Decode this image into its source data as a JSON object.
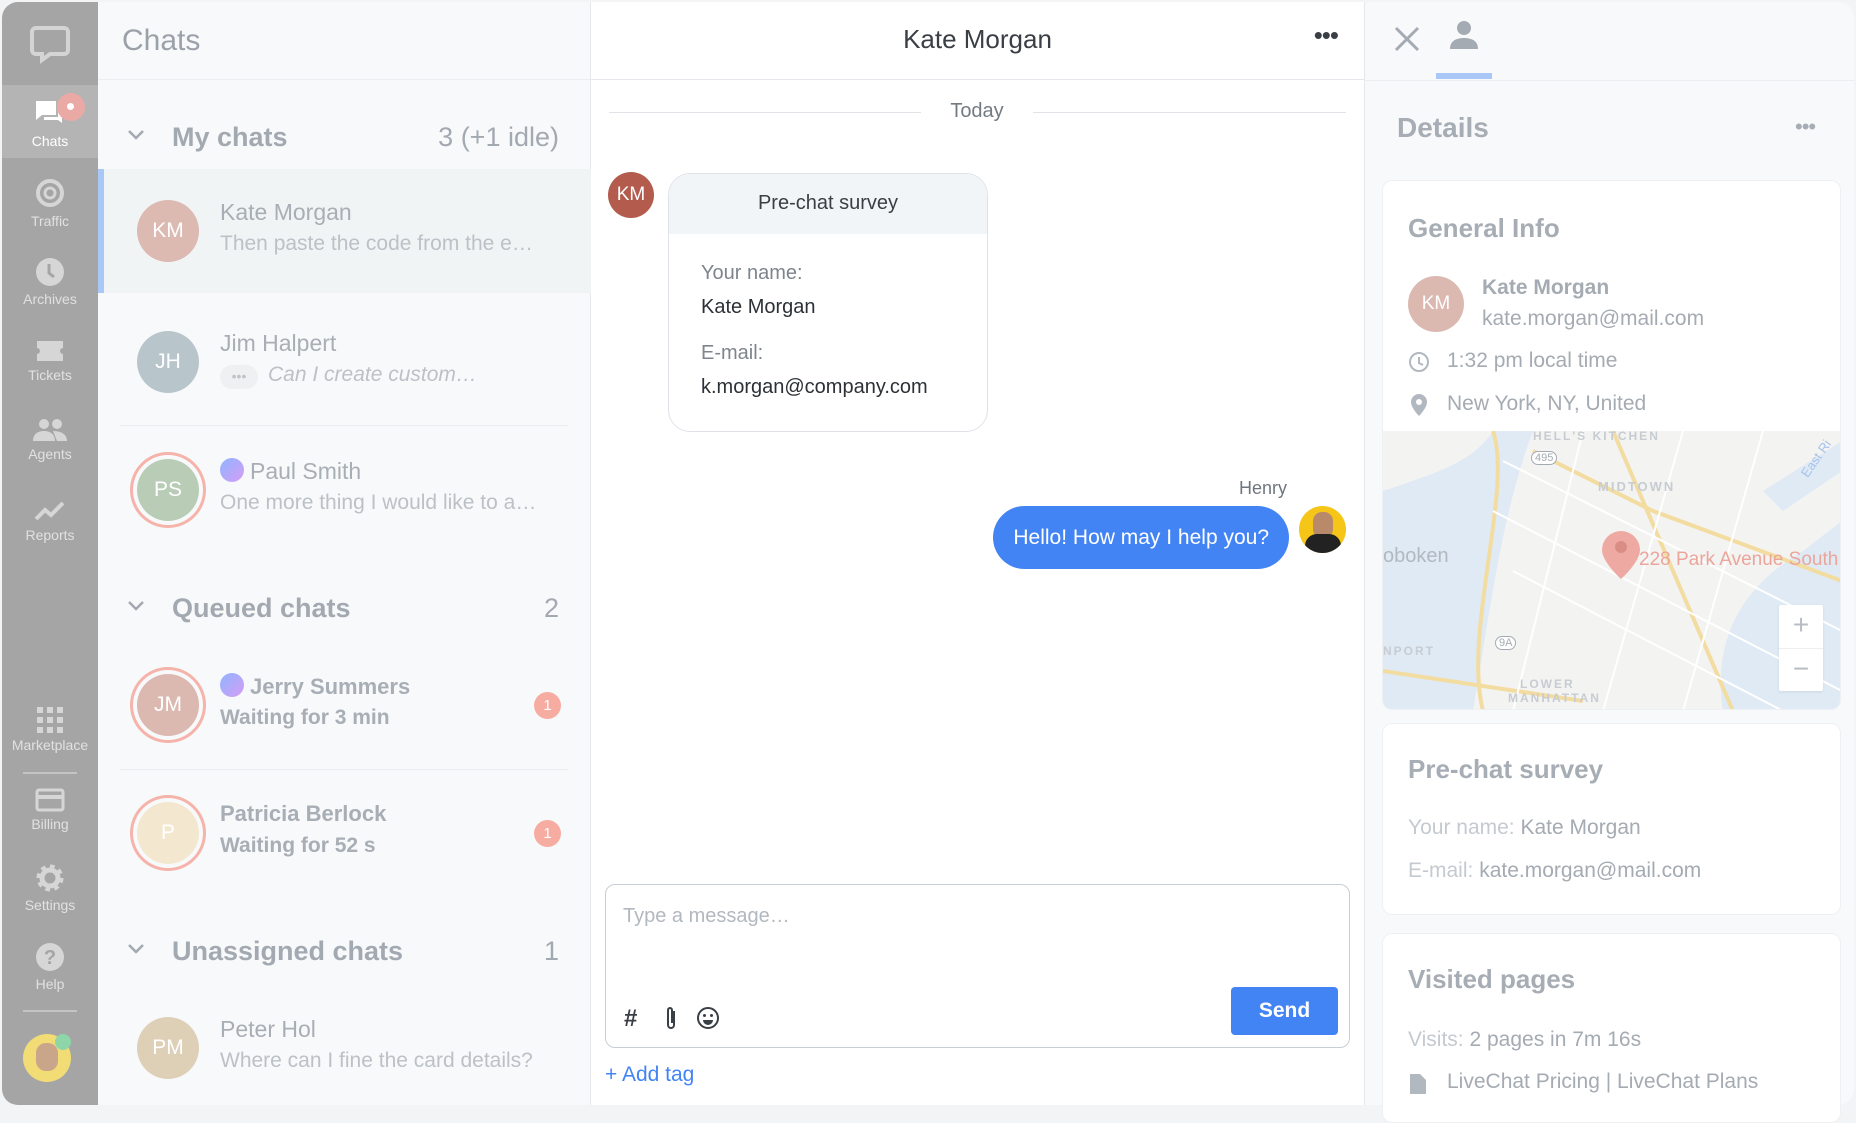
{
  "nav": {
    "items": [
      {
        "label": "Chats",
        "icon": "chats-icon"
      },
      {
        "label": "Traffic",
        "icon": "traffic-icon"
      },
      {
        "label": "Archives",
        "icon": "clock-icon"
      },
      {
        "label": "Tickets",
        "icon": "ticket-icon"
      },
      {
        "label": "Agents",
        "icon": "agents-icon"
      },
      {
        "label": "Reports",
        "icon": "reports-icon"
      },
      {
        "label": "Marketplace",
        "icon": "grid-icon"
      },
      {
        "label": "Billing",
        "icon": "card-icon"
      },
      {
        "label": "Settings",
        "icon": "gear-icon"
      },
      {
        "label": "Help",
        "icon": "help-icon"
      }
    ]
  },
  "list": {
    "title": "Chats",
    "my": {
      "title": "My chats",
      "count": "3 (+1 idle)",
      "chats": [
        {
          "initials": "KM",
          "name": "Kate Morgan",
          "preview": "Then paste the code from the e…",
          "color": "#dcb9b1"
        },
        {
          "initials": "JH",
          "name": "Jim Halpert",
          "preview": "Can I create custom…",
          "color": "#b8c5cb"
        },
        {
          "initials": "PS",
          "name": "Paul Smith",
          "preview": "One more thing I would like to a…",
          "color": "#b9cdb6"
        }
      ]
    },
    "queued": {
      "title": "Queued chats",
      "count": "2",
      "chats": [
        {
          "initials": "JM",
          "name": "Jerry Summers",
          "preview": "Waiting for 3 min",
          "badge": "1",
          "color": "#dbb8b0"
        },
        {
          "initials": "P",
          "name": "Patricia Berlock",
          "preview": "Waiting for 52 s",
          "badge": "1",
          "color": "#f3e8cf"
        }
      ]
    },
    "unassigned": {
      "title": "Unassigned chats",
      "count": "1",
      "chats": [
        {
          "initials": "PM",
          "name": "Peter Hol",
          "preview": "Where can I fine the card details?",
          "color": "#decfb7"
        }
      ]
    }
  },
  "chat": {
    "title": "Kate Morgan",
    "day": "Today",
    "visitor_initials": "KM",
    "survey": {
      "title": "Pre-chat survey",
      "name_label": "Your name:",
      "name": "Kate Morgan",
      "email_label": "E-mail:",
      "email": "k.morgan@company.com"
    },
    "agent_name": "Henry",
    "agent_message": "Hello! How may I help you?",
    "input_placeholder": "Type a message…",
    "send": "Send",
    "add_tag": "+ Add tag",
    "accent": "#4384f5"
  },
  "details": {
    "title": "Details",
    "general": {
      "title": "General Info",
      "initials": "KM",
      "name": "Kate Morgan",
      "email": "kate.morgan@mail.com",
      "local_time": "1:32 pm local time",
      "location": "New York, NY, United",
      "map": {
        "address": "228 Park Avenue South",
        "labels": [
          "HELL'S KITCHEN",
          "MIDTOWN",
          "oboken",
          "LOWER",
          "MANHATTAN",
          "NPORT",
          "495",
          "9A",
          "East Ri"
        ]
      }
    },
    "survey": {
      "title": "Pre-chat survey",
      "name_label": "Your name:",
      "name": "Kate Morgan",
      "email_label": "E-mail:",
      "email": "kate.morgan@mail.com"
    },
    "visited": {
      "title": "Visited pages",
      "visits_label": "Visits:",
      "visits": "2 pages in 7m 16s",
      "page": "LiveChat Pricing | LiveChat Plans"
    }
  }
}
